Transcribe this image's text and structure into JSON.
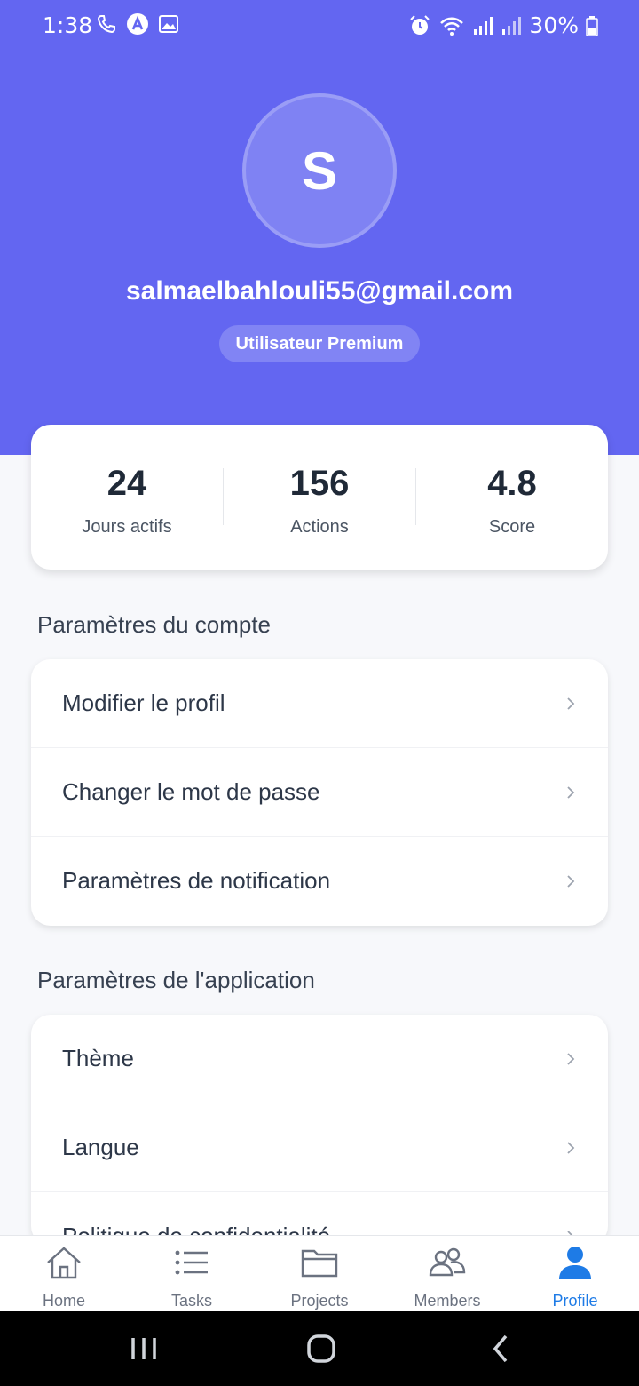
{
  "status_bar": {
    "time": "1:38",
    "battery": "30%"
  },
  "profile": {
    "avatar_letter": "S",
    "email": "salmaelbahlouli55@gmail.com",
    "badge": "Utilisateur Premium"
  },
  "stats": [
    {
      "value": "24",
      "label": "Jours actifs"
    },
    {
      "value": "156",
      "label": "Actions"
    },
    {
      "value": "4.8",
      "label": "Score"
    }
  ],
  "account_section": {
    "title": "Paramètres du compte",
    "items": [
      "Modifier le profil",
      "Changer le mot de passe",
      "Paramètres de notification"
    ]
  },
  "app_section": {
    "title": "Paramètres de l'application",
    "items": [
      "Thème",
      "Langue",
      "Politique de confidentialité"
    ]
  },
  "bottom_nav": [
    {
      "label": "Home",
      "icon": "home-icon",
      "active": false
    },
    {
      "label": "Tasks",
      "icon": "list-icon",
      "active": false
    },
    {
      "label": "Projects",
      "icon": "folder-icon",
      "active": false
    },
    {
      "label": "Members",
      "icon": "members-icon",
      "active": false
    },
    {
      "label": "Profile",
      "icon": "person-icon",
      "active": true
    }
  ],
  "colors": {
    "accent": "#6366f1",
    "nav_active": "#1e7be6"
  }
}
